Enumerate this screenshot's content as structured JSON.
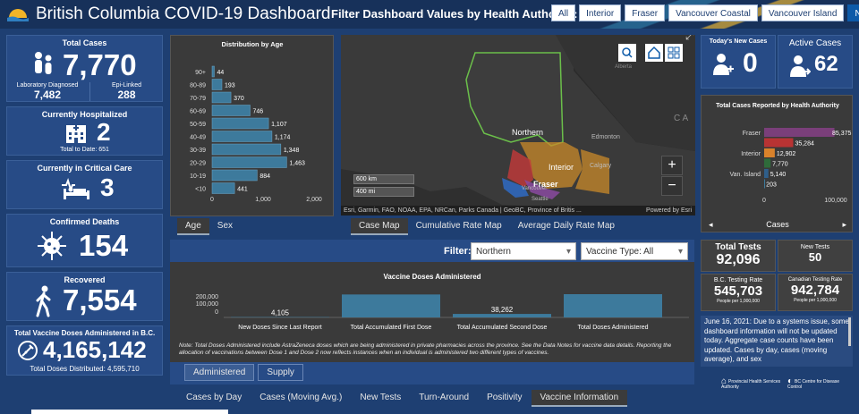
{
  "header": {
    "title": "British Columbia COVID-19 Dashboard",
    "filter_label": "Filter Dashboard Values by Health Authority:",
    "authorities": [
      "All",
      "Interior",
      "Fraser",
      "Vancouver Coastal",
      "Vancouver Island",
      "Northern"
    ],
    "selected_authority": "Northern"
  },
  "total_cases": {
    "title": "Total Cases",
    "value": "7,770",
    "lab_label": "Laboratory Diagnosed",
    "lab_value": "7,482",
    "epi_label": "Epi-Linked",
    "epi_value": "288"
  },
  "hospitalized": {
    "title": "Currently Hospitalized",
    "value": "2",
    "sub": "Total to Date: 651"
  },
  "critical": {
    "title": "Currently in Critical Care",
    "value": "3"
  },
  "deaths": {
    "title": "Confirmed Deaths",
    "value": "154"
  },
  "recovered": {
    "title": "Recovered",
    "value": "7,554"
  },
  "vaccine_total": {
    "title": "Total Vaccine Doses Administered in B.C.",
    "value": "4,165,142",
    "sub": "Total Doses Distributed: 4,595,710"
  },
  "age_chart": {
    "tabs": [
      "Age",
      "Sex"
    ],
    "selected_tab": "Age"
  },
  "map": {
    "labels": {
      "northern": "Northern",
      "interior": "Interior",
      "fraser": "Fraser",
      "edmonton": "Edmonton",
      "calgary": "Calgary",
      "vancouver": "Vancouver",
      "seattle": "Seattle",
      "alberta": "Alberta",
      "ca": "C A"
    },
    "scale_km": "600 km",
    "scale_mi": "400 mi",
    "attribution": "Esri, Garmin, FAO, NOAA, EPA, NRCan, Parks Canada | GeoBC, Province of Britis ...",
    "powered_by": "Powered by Esri",
    "tabs": [
      "Case Map",
      "Cumulative Rate Map",
      "Average Daily Rate Map"
    ],
    "selected_tab": "Case Map",
    "zoom_in": "+",
    "zoom_out": "−",
    "expand": "⤢"
  },
  "new_cases": {
    "title": "Today's New Cases",
    "value": "0"
  },
  "active_cases": {
    "title": "Active Cases",
    "value": "62"
  },
  "ha_chart": {
    "footer": "Cases",
    "prev": "◂",
    "next": "▸"
  },
  "tests": {
    "total_label": "Total Tests",
    "total_value": "92,096",
    "new_label": "New Tests",
    "new_value": "50",
    "bc_rate_label": "B.C. Testing Rate",
    "bc_rate_value": "545,703",
    "bc_rate_unit": "People per 1,000,000",
    "ca_rate_label": "Canadian Testing Rate",
    "ca_rate_value": "942,784",
    "ca_rate_unit": "People per 1,000,000"
  },
  "notice": {
    "text": "June 16, 2021: Due to a systems issue, some dashboard information will not be updated today. Aggregate case counts have been updated. Cases by day, cases (moving average), and sex"
  },
  "vaccine_panel": {
    "filter_label": "Filter:",
    "region_value": "Northern",
    "type_value": "Vaccine Type: All",
    "note": "Note: Total Doses Administered include AstraZeneca doses which are being administered in private pharmacies across the province. See the Data Notes for vaccine data details. Reporting the allocation of vaccinations between Dose 1 and Dose 2 now reflects instances when an individual is administered two different types of vaccines.",
    "tabs": [
      "Administered",
      "Supply"
    ],
    "selected_tab": "Administered"
  },
  "bottom_tabs": [
    "Cases by Day",
    "Cases (Moving Avg.)",
    "New Tests",
    "Turn-Around",
    "Positivity",
    "Vaccine Information"
  ],
  "selected_bottom_tab": "Vaccine Information",
  "footer_logos": {
    "pha": "Provincial Health Services Authority",
    "bccdc": "BC Centre for Disease Control"
  },
  "colors": {
    "bg": "#1e3f72",
    "card": "#274b86",
    "bar": "#3d7a9c",
    "accent": "#0d5aa8"
  },
  "chart_data": [
    {
      "type": "bar",
      "title": "Distribution by Age",
      "orientation": "horizontal",
      "categories": [
        "90+",
        "80-89",
        "70-79",
        "60-69",
        "50-59",
        "40-49",
        "30-39",
        "20-29",
        "10-19",
        "<10"
      ],
      "values": [
        44,
        193,
        370,
        746,
        1107,
        1174,
        1348,
        1463,
        884,
        441
      ],
      "value_labels": [
        "44",
        "193",
        "370",
        "746",
        "1,107",
        "1,174",
        "1,348",
        "1,463",
        "884",
        "441"
      ],
      "xlim": [
        0,
        2000
      ],
      "xticks": [
        "0",
        "1,000",
        "2,000"
      ]
    },
    {
      "type": "bar",
      "title": "Total Cases Reported by Health Authority",
      "orientation": "horizontal",
      "categories": [
        "Fraser",
        "",
        "Interior",
        "",
        "Van. Island",
        ""
      ],
      "values": [
        85375,
        35284,
        12902,
        7770,
        5140,
        203
      ],
      "value_labels": [
        "85,375",
        "35,284",
        "12,902",
        "7,770",
        "5,140",
        "203"
      ],
      "colors": [
        "#7a3f7a",
        "#b83333",
        "#d9822b",
        "#2f6b3a",
        "#2f5f8a",
        "#3d7a9c"
      ],
      "xlim": [
        0,
        100000
      ],
      "xticks": [
        "0",
        "100,000"
      ]
    },
    {
      "type": "bar",
      "title": "Vaccine Doses Administered",
      "categories": [
        "New Doses Since Last Report",
        "Total Accumulated First Dose",
        "Total Accumulated Second Dose",
        "Total Doses Administered"
      ],
      "values": [
        4105,
        250000,
        38262,
        288367
      ],
      "value_labels": [
        "4,105",
        "",
        "38,262",
        ""
      ],
      "ylim": [
        0,
        300000
      ],
      "yticks": [
        "200,000",
        "100,000",
        "0"
      ]
    }
  ]
}
